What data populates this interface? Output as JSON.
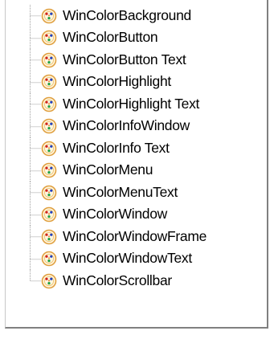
{
  "tree": {
    "icon": "enum-value-icon",
    "colors": {
      "connector": "#a0a0a0",
      "frame_shadow": "#808080",
      "icon_ring_outer": "#e0a040",
      "icon_dot_red": "#d02020",
      "icon_dot_blue": "#2040c0",
      "icon_dot_green": "#20a040"
    },
    "items": [
      {
        "label": "WinColorBackground"
      },
      {
        "label": "WinColorButton"
      },
      {
        "label": "WinColorButton Text"
      },
      {
        "label": "WinColorHighlight"
      },
      {
        "label": "WinColorHighlight Text"
      },
      {
        "label": "WinColorInfoWindow"
      },
      {
        "label": "WinColorInfo Text"
      },
      {
        "label": "WinColorMenu"
      },
      {
        "label": "WinColorMenuText"
      },
      {
        "label": "WinColorWindow"
      },
      {
        "label": "WinColorWindowFrame"
      },
      {
        "label": "WinColorWindowText"
      },
      {
        "label": "WinColorScrollbar"
      }
    ]
  }
}
